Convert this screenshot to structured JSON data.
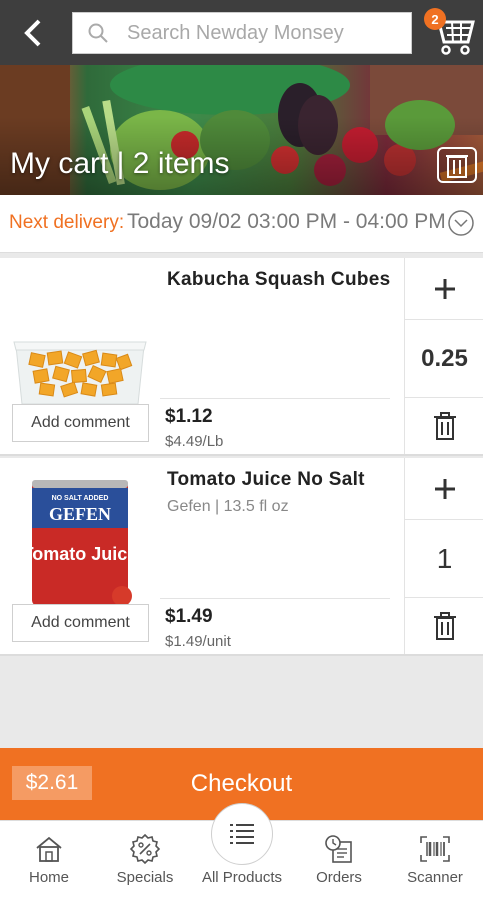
{
  "header": {
    "search_placeholder": "Search Newday Monsey",
    "cart_count": "2"
  },
  "hero": {
    "title": "My cart | 2 items"
  },
  "delivery": {
    "label": "Next delivery:",
    "value": "Today 09/02 03:00 PM - 04:00 PM"
  },
  "items": [
    {
      "name": "Kabucha Squash Cubes",
      "subtitle": "",
      "price": "$1.12",
      "unit_price": "$4.49/Lb",
      "quantity": "0.25",
      "comment_label": "Add comment"
    },
    {
      "name": "Tomato Juice No Salt",
      "subtitle": "Gefen | 13.5 fl oz",
      "price": "$1.49",
      "unit_price": "$1.49/unit",
      "quantity": "1",
      "comment_label": "Add comment",
      "can_label_brand": "GEFEN",
      "can_label_product": "Tomato Juice",
      "can_label_top": "NO SALT ADDED"
    }
  ],
  "checkout": {
    "total": "$2.61",
    "label": "Checkout"
  },
  "nav": [
    {
      "label": "Home",
      "icon": "home-icon"
    },
    {
      "label": "Specials",
      "icon": "percent-icon"
    },
    {
      "label": "All Products",
      "icon": "list-icon"
    },
    {
      "label": "Orders",
      "icon": "orders-icon"
    },
    {
      "label": "Scanner",
      "icon": "barcode-icon"
    }
  ],
  "colors": {
    "accent": "#f07122",
    "topbar": "#3e3e3e",
    "total_bg": "#f59b63"
  }
}
